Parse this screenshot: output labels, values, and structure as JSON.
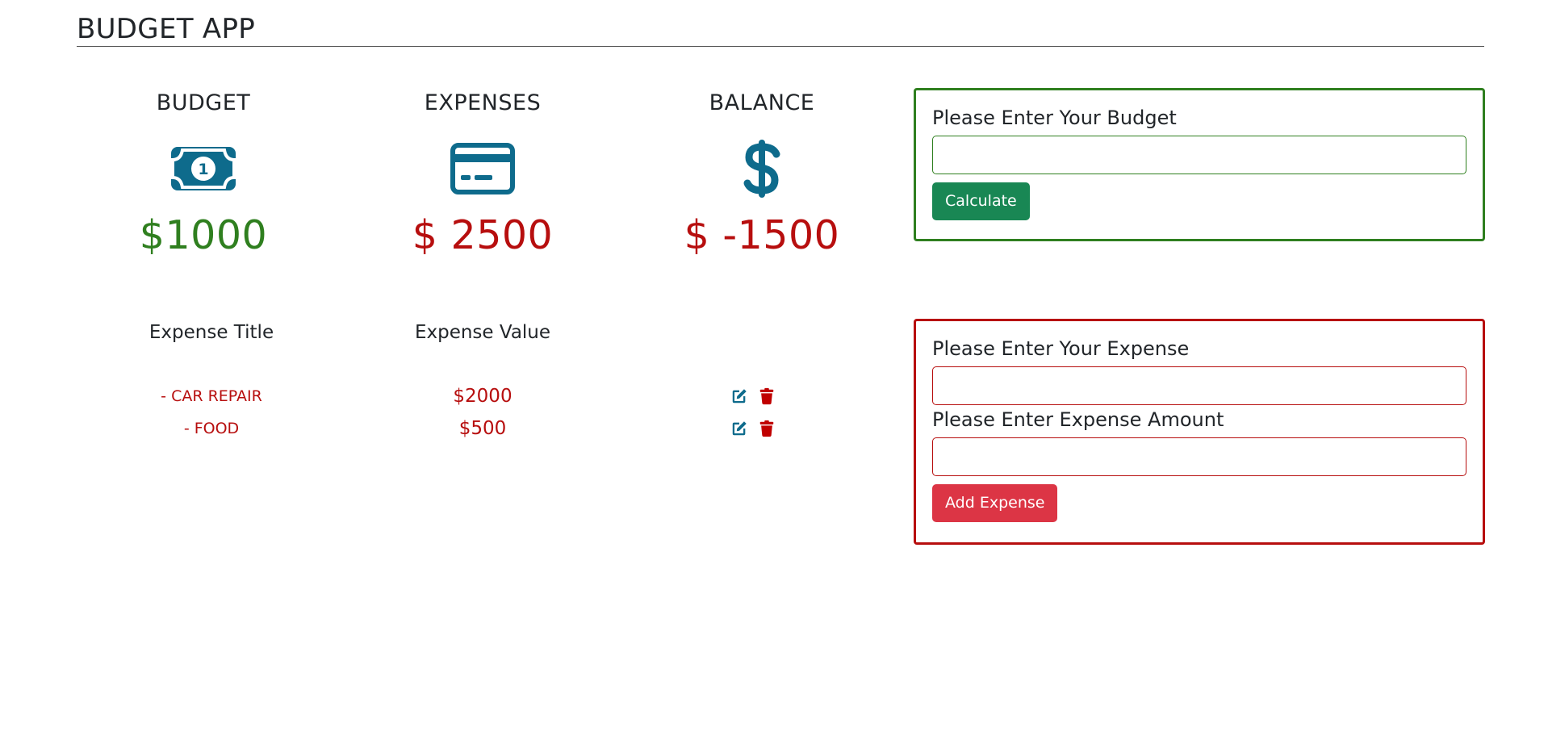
{
  "app": {
    "title": "BUDGET APP"
  },
  "summary": {
    "budget": {
      "heading": "BUDGET",
      "amount": "$1000",
      "icon": "money-bill-icon"
    },
    "expenses": {
      "heading": "EXPENSES",
      "amount": "$ 2500",
      "icon": "credit-card-icon"
    },
    "balance": {
      "heading": "BALANCE",
      "amount": "$ -1500",
      "icon": "dollar-sign-icon"
    }
  },
  "list": {
    "headers": {
      "title": "Expense Title",
      "value": "Expense Value"
    },
    "items": [
      {
        "title": "- CAR REPAIR",
        "value": "$2000"
      },
      {
        "title": "- FOOD",
        "value": "$500"
      }
    ]
  },
  "budget_form": {
    "label": "Please Enter Your Budget",
    "value": "",
    "button": "Calculate"
  },
  "expense_form": {
    "title_label": "Please Enter Your Expense",
    "title_value": "",
    "amount_label": "Please Enter Expense Amount",
    "amount_value": "",
    "button": "Add Expense"
  },
  "colors": {
    "accent_blue": "#0e6b8c",
    "positive_green": "#2f7f1f",
    "negative_red": "#b70e0e",
    "button_green": "#198754",
    "button_red": "#dc3545"
  }
}
